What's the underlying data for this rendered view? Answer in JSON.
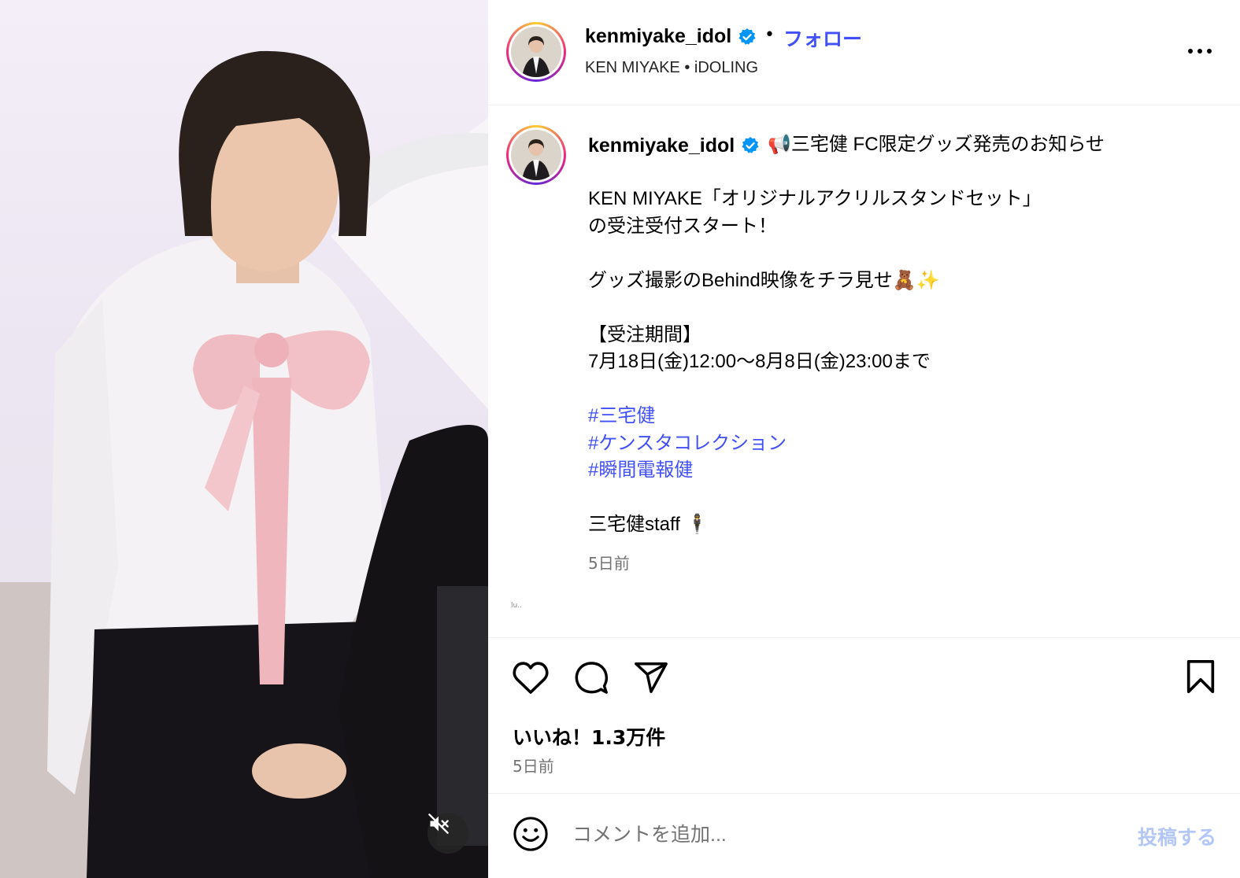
{
  "post": {
    "username": "kenmiyake_idol",
    "follow_label": "フォロー",
    "separator": "•",
    "subtitle": "KEN MIYAKE • iDOLING",
    "more_label": "…"
  },
  "caption": {
    "username": "kenmiyake_idol",
    "lines": [
      "📢三宅健 FC限定グッズ発売のお知らせ",
      "",
      "KEN MIYAKE「オリジナルアクリルスタンドセット」",
      "の受注受付スタート！",
      "",
      "グッズ撮影のBehind映像をチラ見せ🧸✨",
      "",
      "【受注期間】",
      "7月18日(金)12:00〜8月8日(金)23:00まで",
      ""
    ],
    "hashtags": [
      "#三宅健",
      "#ケンスタコレクション",
      "#瞬間電報健"
    ],
    "signature": "三宅健staff 🕴",
    "time": "5日前",
    "tiny_text": "lu.."
  },
  "actions": {
    "likes": "いいね！1.3万件",
    "time": "5日前"
  },
  "comment": {
    "placeholder": "コメントを追加...",
    "post_label": "投稿する"
  },
  "colors": {
    "link": "#4150f7",
    "verified": "#0095f6",
    "muted": "#737373",
    "post_disabled": "#b3c7f7"
  },
  "icons": [
    "volume-off-icon",
    "verified-badge-icon",
    "more-icon",
    "heart-icon",
    "comment-icon",
    "share-icon",
    "bookmark-icon",
    "emoji-icon"
  ]
}
